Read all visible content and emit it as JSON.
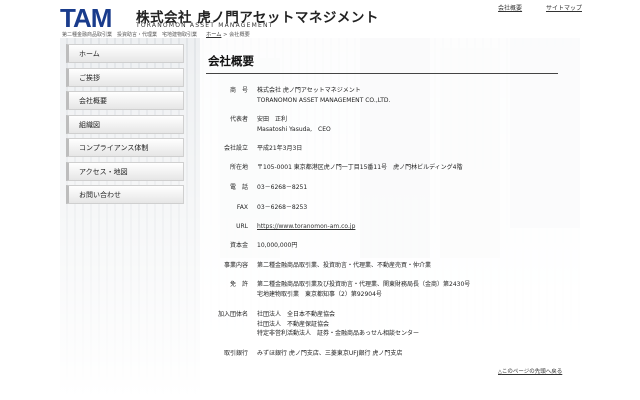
{
  "header": {
    "logo_mark": "TAM",
    "company_name": "株式会社 虎ノ門アセットマネジメント",
    "company_name_en": "TORANOMON ASSET MANAGEMENT",
    "registration_line": "第二種金融商品取引業　投資助言・代理業　宅地建物取引業",
    "top_links": [
      "会社概要",
      "サイトマップ"
    ]
  },
  "breadcrumb": {
    "home": "ホーム",
    "separator": ">",
    "current": "会社概要"
  },
  "sidebar": {
    "items": [
      {
        "label": "ホーム"
      },
      {
        "label": "ご挨拶"
      },
      {
        "label": "会社概要"
      },
      {
        "label": "組織図"
      },
      {
        "label": "コンプライアンス体制"
      },
      {
        "label": "アクセス・地図"
      },
      {
        "label": "お問い合わせ"
      }
    ]
  },
  "main": {
    "title": "会社概要",
    "rows": [
      {
        "label": "商　号",
        "lines": [
          "株式会社 虎ノ門アセットマネジメント",
          "TORANOMON ASSET MANAGEMENT CO.,LTD."
        ]
      },
      {
        "label": "代表者",
        "lines": [
          "安田　正利",
          "Masatoshi Yasuda,　CEO"
        ]
      },
      {
        "label": "会社設立",
        "lines": [
          "平成21年3月3日"
        ]
      },
      {
        "label": "所在地",
        "lines": [
          "〒105-0001 東京都港区虎ノ門一丁目15番11号　虎ノ門林ビルディング4階"
        ]
      },
      {
        "label": "電　話",
        "lines": [
          "03－6268－8251"
        ]
      },
      {
        "label": "FAX",
        "lines": [
          "03－6268－8253"
        ]
      },
      {
        "label": "URL",
        "lines": [
          "https://www.toranomon-am.co.jp"
        ]
      },
      {
        "label": "資本金",
        "lines": [
          "10,000,000円"
        ]
      },
      {
        "label": "事業内容",
        "lines": [
          "第二種金融商品取引業、投資助言・代理業、不動産売買・仲介業"
        ]
      },
      {
        "label": "免　許",
        "lines": [
          "第二種金融商品取引業及び投資助言・代理業、関東財務局長（金商）第2430号",
          "宅地建物取引業　東京都知事（2）第92904号"
        ]
      },
      {
        "label": "加入団体名",
        "lines": [
          "社団法人　全日本不動産協会",
          "社団法人　不動産保証協会",
          "特定非営利活動法人　証券・金融商品あっせん相談センター"
        ]
      },
      {
        "label": "取引銀行",
        "lines": [
          "みずほ銀行 虎ノ門支店、三菱東京UFJ銀行 虎ノ門支店"
        ]
      }
    ],
    "back_to_top": "このページの先頭へ戻る",
    "back_to_top_arrow": "△"
  },
  "colors": {
    "logo_blue": "#1a3c8c",
    "logo_yellow": "#f0a800",
    "rule": "#444444"
  }
}
